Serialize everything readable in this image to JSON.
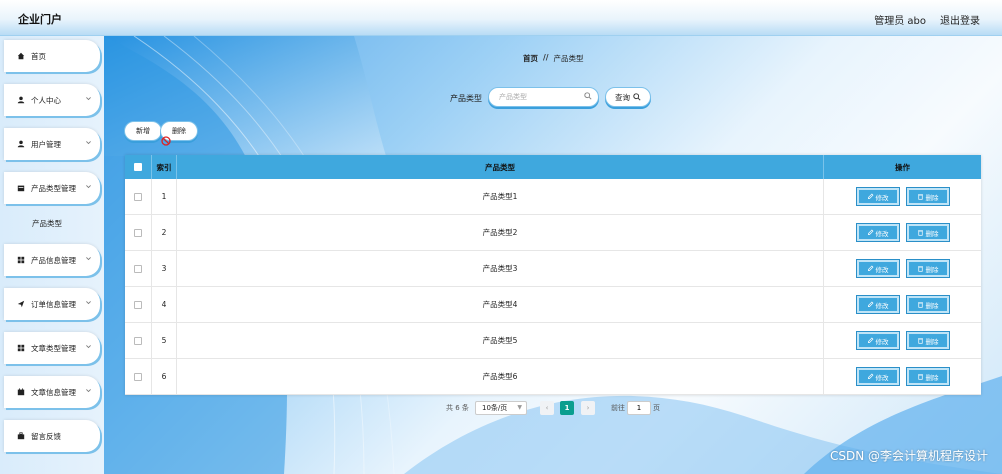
{
  "header": {
    "title": "企业门户",
    "user": "管理员 abo",
    "logout": "退出登录"
  },
  "sidebar": {
    "items": [
      {
        "label": "首页",
        "icon": "home-icon"
      },
      {
        "label": "个人中心",
        "icon": "user-icon"
      },
      {
        "label": "用户管理",
        "icon": "user-icon"
      },
      {
        "label": "产品类型管理",
        "icon": "folder-icon"
      },
      {
        "label": "产品信息管理",
        "icon": "grid-icon"
      },
      {
        "label": "订单信息管理",
        "icon": "send-icon"
      },
      {
        "label": "文章类型管理",
        "icon": "grid-icon"
      },
      {
        "label": "文章信息管理",
        "icon": "calendar-icon"
      },
      {
        "label": "留言反馈",
        "icon": "suitcase-icon"
      }
    ],
    "submenu": "产品类型"
  },
  "breadcrumb": {
    "home": "首页",
    "sep": "//",
    "current": "产品类型"
  },
  "search": {
    "label": "产品类型",
    "placeholder": "产品类型",
    "value": "",
    "button": "查询"
  },
  "actions": {
    "add": "新增",
    "delete": "删除"
  },
  "table": {
    "headers": {
      "index": "索引",
      "name": "产品类型",
      "ops": "操作"
    },
    "rows": [
      {
        "index": "1",
        "name": "产品类型1"
      },
      {
        "index": "2",
        "name": "产品类型2"
      },
      {
        "index": "3",
        "name": "产品类型3"
      },
      {
        "index": "4",
        "name": "产品类型4"
      },
      {
        "index": "5",
        "name": "产品类型5"
      },
      {
        "index": "6",
        "name": "产品类型6"
      }
    ],
    "edit_label": "修改",
    "delete_label": "删除"
  },
  "pagination": {
    "total": "共 6 条",
    "page_size": "10条/页",
    "prev": "‹",
    "current": "1",
    "next": "›",
    "goto_prefix": "前往",
    "goto_value": "1",
    "goto_suffix": "页"
  },
  "watermark": "CSDN @李会计算机程序设计",
  "colors": {
    "accent": "#3fa8de",
    "pager_active": "#0a9e8f"
  }
}
